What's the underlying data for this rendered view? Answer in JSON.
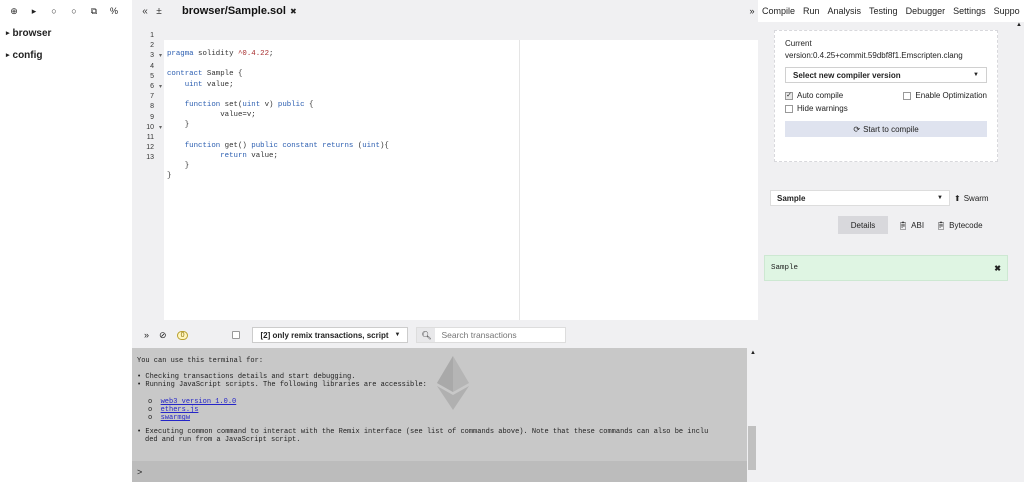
{
  "left": {
    "toolbar_icons": [
      "plus-circle-icon",
      "folder-open-icon",
      "github-icon",
      "github-publish-icon",
      "copy-icon",
      "link-icon"
    ],
    "toolbar_glyphs": [
      "⊕",
      "▸",
      "○",
      "○",
      "⧉",
      "%"
    ],
    "tree": [
      {
        "label": "browser"
      },
      {
        "label": "config"
      }
    ]
  },
  "editor": {
    "nav_left": "«",
    "nav_plus": "±",
    "tab_title": "browser/Sample.sol",
    "tab_close": "✖",
    "lines": [
      {
        "n": "1",
        "fold": "",
        "tokens": [
          [
            "kw",
            "pragma"
          ],
          [
            "pl",
            " solidity "
          ],
          [
            "str",
            "^0.4.22"
          ],
          [
            "pl",
            ";"
          ]
        ]
      },
      {
        "n": "2",
        "fold": "",
        "tokens": []
      },
      {
        "n": "3",
        "fold": "▾",
        "tokens": [
          [
            "kw",
            "contract"
          ],
          [
            "pl",
            " Sample {"
          ]
        ]
      },
      {
        "n": "4",
        "fold": "",
        "tokens": [
          [
            "pl",
            "    "
          ],
          [
            "kw",
            "uint"
          ],
          [
            "pl",
            " value;"
          ]
        ]
      },
      {
        "n": "5",
        "fold": "",
        "tokens": []
      },
      {
        "n": "6",
        "fold": "▾",
        "tokens": [
          [
            "pl",
            "    "
          ],
          [
            "kw",
            "function"
          ],
          [
            "pl",
            " set("
          ],
          [
            "kw",
            "uint"
          ],
          [
            "pl",
            " v) "
          ],
          [
            "kw",
            "public"
          ],
          [
            "pl",
            " {"
          ]
        ]
      },
      {
        "n": "7",
        "fold": "",
        "tokens": [
          [
            "pl",
            "            value=v;"
          ]
        ]
      },
      {
        "n": "8",
        "fold": "",
        "tokens": [
          [
            "pl",
            "    }"
          ]
        ]
      },
      {
        "n": "9",
        "fold": "",
        "tokens": []
      },
      {
        "n": "10",
        "fold": "▾",
        "tokens": [
          [
            "pl",
            "    "
          ],
          [
            "kw",
            "function"
          ],
          [
            "pl",
            " get() "
          ],
          [
            "kw",
            "public"
          ],
          [
            "pl",
            " "
          ],
          [
            "kw",
            "constant"
          ],
          [
            "pl",
            " "
          ],
          [
            "kw",
            "returns"
          ],
          [
            "pl",
            " ("
          ],
          [
            "kw",
            "uint"
          ],
          [
            "pl",
            ")"
          ],
          [
            "pl",
            "{"
          ]
        ]
      },
      {
        "n": "11",
        "fold": "",
        "tokens": [
          [
            "pl",
            "            "
          ],
          [
            "kw",
            "return"
          ],
          [
            "pl",
            " value;"
          ]
        ]
      },
      {
        "n": "12",
        "fold": "",
        "tokens": [
          [
            "pl",
            "    }"
          ]
        ]
      },
      {
        "n": "13",
        "fold": "",
        "tokens": [
          [
            "pl",
            "}"
          ]
        ]
      }
    ]
  },
  "terminal": {
    "collapse_glyph": "»",
    "clear_glyph": "⊘",
    "pending_count": "0",
    "filter_label": "[2] only remix transactions, script",
    "search_placeholder": "Search transactions",
    "intro": "You can use this terminal for:",
    "bullet1": "Checking transactions details and start debugging.",
    "bullet2": "Running JavaScript scripts. The following libraries are accessible:",
    "libs": [
      "web3 version 1.0.0",
      "ethers.js",
      "swarmgw"
    ],
    "bullet3_line1": "Executing common command to interact with the Remix interface (see list of commands above). Note that these commands can also be inclu",
    "bullet3_line2": "ded and run from a JavaScript script.",
    "prompt": ">"
  },
  "right": {
    "nav": "»",
    "tabs": [
      "Compile",
      "Run",
      "Analysis",
      "Testing",
      "Debugger",
      "Settings",
      "Suppo"
    ],
    "current_label": "Current",
    "current_version": "version:0.4.25+commit.59dbf8f1.Emscripten.clang",
    "select_compiler": "Select new compiler version",
    "auto_compile": "Auto compile",
    "enable_optimization": "Enable Optimization",
    "hide_warnings": "Hide warnings",
    "start_compile": "Start to compile",
    "contract_name": "Sample",
    "swarm": "Swarm",
    "details": "Details",
    "abi": "ABI",
    "bytecode": "Bytecode",
    "result": "Sample",
    "result_close": "✖"
  }
}
